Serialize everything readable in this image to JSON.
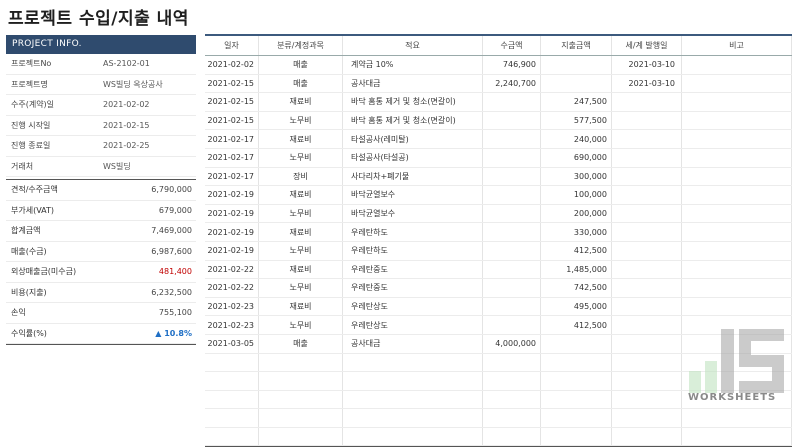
{
  "title": "프로젝트 수입/지출 내역",
  "info_panel": {
    "header": "PROJECT INFO.",
    "fields": [
      {
        "label": "프로젝트No",
        "value": "AS-2102-01"
      },
      {
        "label": "프로젝트명",
        "value": "WS빌딩 옥상공사"
      },
      {
        "label": "수주(계약)일",
        "value": "2021-02-02"
      },
      {
        "label": "진행 시작일",
        "value": "2021-02-15"
      },
      {
        "label": "진행 종료일",
        "value": "2021-02-25"
      },
      {
        "label": "거래처",
        "value": "WS빌딩"
      }
    ],
    "financials": [
      {
        "label": "견적/수주금액",
        "value": "6,790,000",
        "style": "normal"
      },
      {
        "label": "부가세(VAT)",
        "value": "679,000",
        "style": "normal"
      },
      {
        "label": "합계금액",
        "value": "7,469,000",
        "style": "normal"
      },
      {
        "label": "매출(수금)",
        "value": "6,987,600",
        "style": "normal"
      },
      {
        "label": "외상매출금(미수금)",
        "value": "481,400",
        "style": "red"
      },
      {
        "label": "비용(지출)",
        "value": "6,232,500",
        "style": "normal"
      },
      {
        "label": "손익",
        "value": "755,100",
        "style": "normal"
      },
      {
        "label": "수익률(%)",
        "value": "▲ 10.8%",
        "style": "blue"
      }
    ]
  },
  "table": {
    "headers": [
      "일자",
      "분류/계정과목",
      "적요",
      "수금액",
      "지출금액",
      "세/계 발행일",
      "비고"
    ],
    "rows": [
      [
        "2021-02-02",
        "매출",
        "계약금 10%",
        "746,900",
        "",
        "2021-03-10",
        ""
      ],
      [
        "2021-02-15",
        "매출",
        "공사대금",
        "2,240,700",
        "",
        "2021-03-10",
        ""
      ],
      [
        "2021-02-15",
        "재료비",
        "바닥 홈통 제거 및 청소(면갈이)",
        "",
        "247,500",
        "",
        ""
      ],
      [
        "2021-02-15",
        "노무비",
        "바닥 홈통 제거 및 청소(면갈이)",
        "",
        "577,500",
        "",
        ""
      ],
      [
        "2021-02-17",
        "재료비",
        "타설공사(레미탈)",
        "",
        "240,000",
        "",
        ""
      ],
      [
        "2021-02-17",
        "노무비",
        "타설공사(타설공)",
        "",
        "690,000",
        "",
        ""
      ],
      [
        "2021-02-17",
        "장비",
        "사다리차+폐기물",
        "",
        "300,000",
        "",
        ""
      ],
      [
        "2021-02-19",
        "재료비",
        "바닥균열보수",
        "",
        "100,000",
        "",
        ""
      ],
      [
        "2021-02-19",
        "노무비",
        "바닥균열보수",
        "",
        "200,000",
        "",
        ""
      ],
      [
        "2021-02-19",
        "재료비",
        "우레탄하도",
        "",
        "330,000",
        "",
        ""
      ],
      [
        "2021-02-19",
        "노무비",
        "우레탄하도",
        "",
        "412,500",
        "",
        ""
      ],
      [
        "2021-02-22",
        "재료비",
        "우레탄중도",
        "",
        "1,485,000",
        "",
        ""
      ],
      [
        "2021-02-22",
        "노무비",
        "우레탄중도",
        "",
        "742,500",
        "",
        ""
      ],
      [
        "2021-02-23",
        "재료비",
        "우레탄상도",
        "",
        "495,000",
        "",
        ""
      ],
      [
        "2021-02-23",
        "노무비",
        "우레탄상도",
        "",
        "412,500",
        "",
        ""
      ],
      [
        "2021-03-05",
        "매출",
        "공사대금",
        "4,000,000",
        "",
        "",
        ""
      ],
      [
        "",
        "",
        "",
        "",
        "",
        "",
        ""
      ],
      [
        "",
        "",
        "",
        "",
        "",
        "",
        ""
      ],
      [
        "",
        "",
        "",
        "",
        "",
        "",
        ""
      ],
      [
        "",
        "",
        "",
        "",
        "",
        "",
        ""
      ],
      [
        "",
        "",
        "",
        "",
        "",
        "",
        ""
      ]
    ]
  },
  "watermark": {
    "text": "WORKSHEETS",
    "icon": "worksheets-logo-icon"
  },
  "colors": {
    "header_bg": "#2f4b6e",
    "negative": "#c00000",
    "positive": "#1f6fc5"
  }
}
